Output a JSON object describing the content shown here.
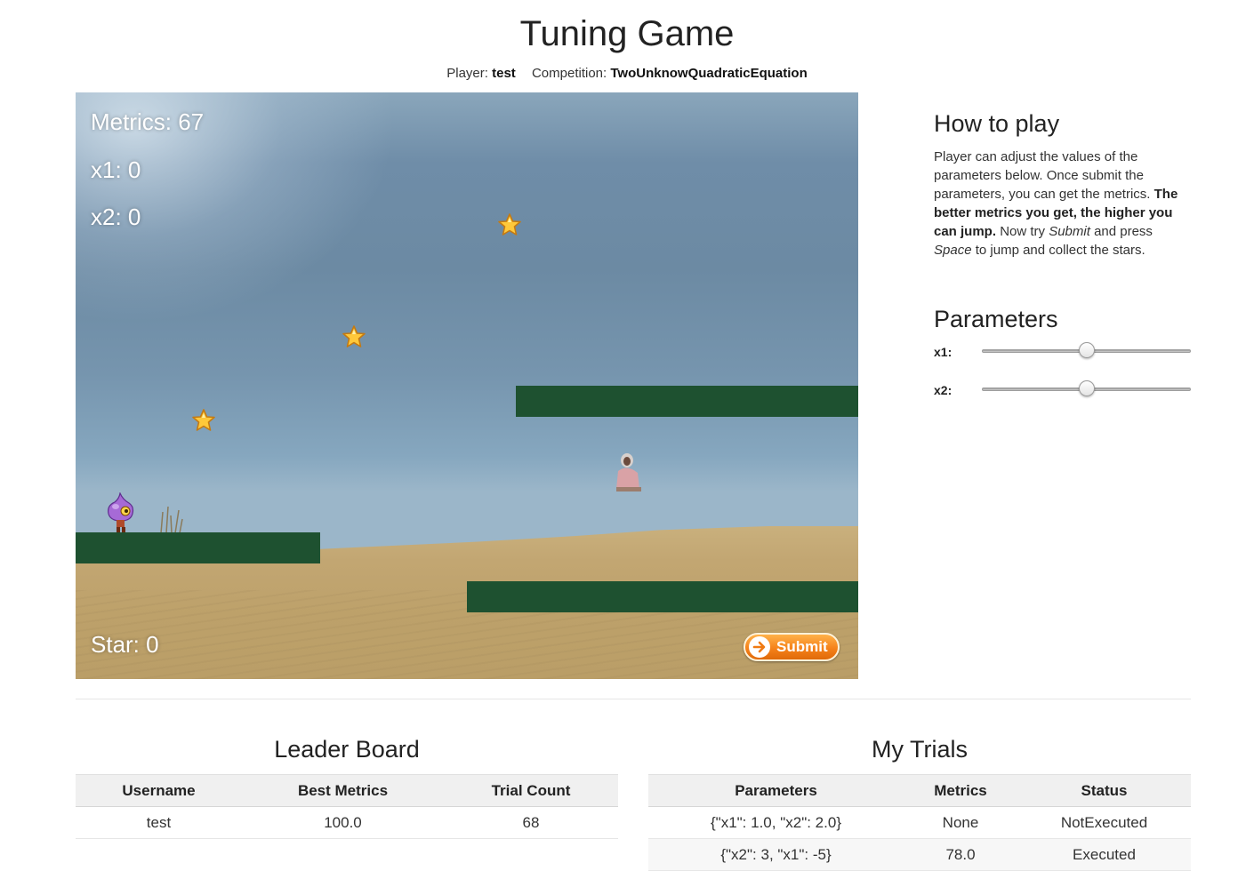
{
  "header": {
    "title": "Tuning Game",
    "player_label": "Player:",
    "player_name": "test",
    "competition_label": "Competition:",
    "competition_name": "TwoUnknowQuadraticEquation"
  },
  "game": {
    "hud": {
      "metrics": "Metrics: 67",
      "x1": "x1: 0",
      "x2": "x2: 0",
      "star": "Star: 0"
    },
    "submit_label": "Submit",
    "platform_color": "#1e5130"
  },
  "how_to_play": {
    "title": "How to play",
    "text_1": "Player can adjust the values of the parameters below. Once submit the parameters, you can get the metrics.",
    "text_bold": "The better metrics you get, the higher you can jump.",
    "text_2": "Now try",
    "text_submit": "Submit",
    "text_3": "and press",
    "text_space": "Space",
    "text_4": "to jump and collect the stars."
  },
  "parameters": {
    "title": "Parameters",
    "x1_label": "x1:",
    "x2_label": "x2:",
    "x1_level": 0.5,
    "x2_level": 0.5
  },
  "leaderboard": {
    "title": "Leader Board",
    "columns": [
      "Username",
      "Best Metrics",
      "Trial Count"
    ],
    "rows": [
      [
        "test",
        "100.0",
        "68"
      ]
    ]
  },
  "trials": {
    "title": "My Trials",
    "columns": [
      "Parameters",
      "Metrics",
      "Status"
    ],
    "rows": [
      [
        "{\"x1\": 1.0, \"x2\": 2.0}",
        "None",
        "NotExecuted"
      ],
      [
        "{\"x2\": 3, \"x1\": -5}",
        "78.0",
        "Executed"
      ]
    ]
  }
}
